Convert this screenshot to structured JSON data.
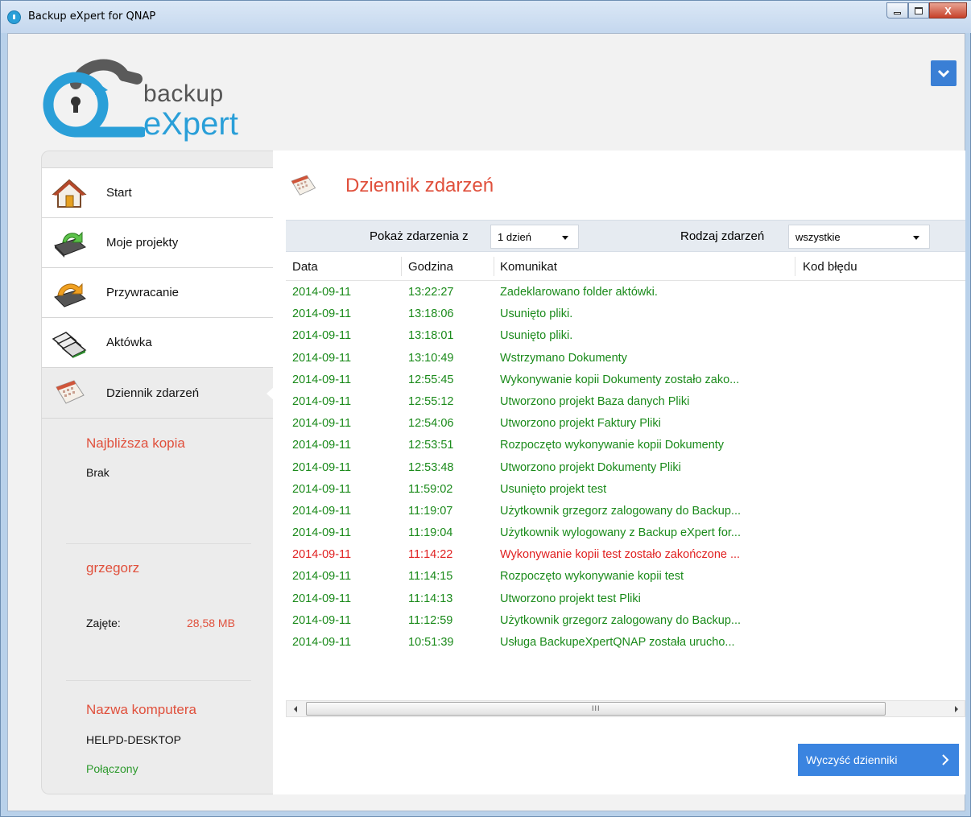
{
  "window": {
    "title": "Backup eXpert for QNAP",
    "close_label": "X"
  },
  "logo": {
    "line1": "backup",
    "line2": "eXpert"
  },
  "nav": {
    "items": [
      {
        "label": "Start",
        "icon": "home-icon"
      },
      {
        "label": "Moje projekty",
        "icon": "projects-icon"
      },
      {
        "label": "Przywracanie",
        "icon": "restore-icon"
      },
      {
        "label": "Aktówka",
        "icon": "briefcase-icon"
      },
      {
        "label": "Dziennik zdarzeń",
        "icon": "event-log-icon",
        "active": true
      }
    ]
  },
  "sidebar": {
    "next_backup_heading": "Najbliższa kopia",
    "next_backup_value": "Brak",
    "user_name": "grzegorz",
    "used_label": "Zajęte:",
    "used_value": "28,58 MB",
    "computer_heading": "Nazwa komputera",
    "computer_name": "HELPD-DESKTOP",
    "connection_status": "Połączony"
  },
  "page": {
    "title": "Dziennik zdarzeń"
  },
  "filters": {
    "period_label": "Pokaż zdarzenia z",
    "period_value": "1 dzień",
    "type_label": "Rodzaj zdarzeń",
    "type_value": "wszystkie"
  },
  "log": {
    "columns": [
      "Data",
      "Godzina",
      "Komunikat",
      "Kod błędu"
    ],
    "rows": [
      {
        "date": "2014-09-11",
        "time": "13:22:27",
        "message": "Zadeklarowano folder aktówki.",
        "code": "",
        "level": "ok"
      },
      {
        "date": "2014-09-11",
        "time": "13:18:06",
        "message": "Usunięto pliki.",
        "code": "",
        "level": "ok"
      },
      {
        "date": "2014-09-11",
        "time": "13:18:01",
        "message": "Usunięto pliki.",
        "code": "",
        "level": "ok"
      },
      {
        "date": "2014-09-11",
        "time": "13:10:49",
        "message": "Wstrzymano Dokumenty",
        "code": "",
        "level": "ok"
      },
      {
        "date": "2014-09-11",
        "time": "12:55:45",
        "message": "Wykonywanie kopii Dokumenty zostało zako...",
        "code": "",
        "level": "ok"
      },
      {
        "date": "2014-09-11",
        "time": "12:55:12",
        "message": "Utworzono projekt Baza danych Pliki",
        "code": "",
        "level": "ok"
      },
      {
        "date": "2014-09-11",
        "time": "12:54:06",
        "message": "Utworzono projekt Faktury Pliki",
        "code": "",
        "level": "ok"
      },
      {
        "date": "2014-09-11",
        "time": "12:53:51",
        "message": "Rozpoczęto wykonywanie kopii Dokumenty",
        "code": "",
        "level": "ok"
      },
      {
        "date": "2014-09-11",
        "time": "12:53:48",
        "message": "Utworzono projekt Dokumenty Pliki",
        "code": "",
        "level": "ok"
      },
      {
        "date": "2014-09-11",
        "time": "11:59:02",
        "message": "Usunięto projekt test",
        "code": "",
        "level": "ok"
      },
      {
        "date": "2014-09-11",
        "time": "11:19:07",
        "message": "Użytkownik grzegorz zalogowany do Backup...",
        "code": "",
        "level": "ok"
      },
      {
        "date": "2014-09-11",
        "time": "11:19:04",
        "message": "Użytkownik  wylogowany z Backup eXpert for...",
        "code": "",
        "level": "ok"
      },
      {
        "date": "2014-09-11",
        "time": "11:14:22",
        "message": "Wykonywanie kopii test zostało zakończone ...",
        "code": "",
        "level": "err"
      },
      {
        "date": "2014-09-11",
        "time": "11:14:15",
        "message": "Rozpoczęto wykonywanie kopii test",
        "code": "",
        "level": "ok"
      },
      {
        "date": "2014-09-11",
        "time": "11:14:13",
        "message": "Utworzono projekt test Pliki",
        "code": "",
        "level": "ok"
      },
      {
        "date": "2014-09-11",
        "time": "11:12:59",
        "message": "Użytkownik grzegorz zalogowany do Backup...",
        "code": "",
        "level": "ok"
      },
      {
        "date": "2014-09-11",
        "time": "10:51:39",
        "message": "Usługa BackupeXpertQNAP została urucho...",
        "code": "",
        "level": "ok"
      }
    ]
  },
  "scrollbar": {
    "grip": "III"
  },
  "actions": {
    "clear_label": "Wyczyść dzienniki"
  },
  "colors": {
    "accent": "#e0503c",
    "brand_blue": "#2a9fd8",
    "button_blue": "#3a84e0",
    "ok_text": "#1a8a1a",
    "error_text": "#e02020"
  }
}
